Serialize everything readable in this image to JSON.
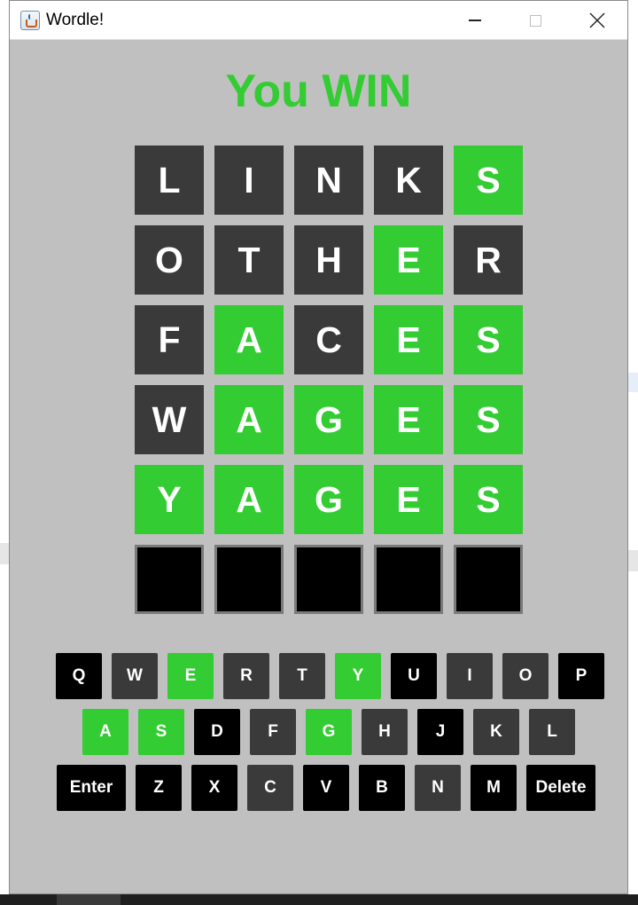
{
  "window": {
    "title": "Wordle!",
    "icon": "java-cup-icon"
  },
  "headline": "You WIN",
  "colors": {
    "green": "#33cc33",
    "gray": "#3a3a3a",
    "black": "#000000",
    "background": "#c0c0c0"
  },
  "board": {
    "rows": [
      [
        {
          "letter": "L",
          "state": "gray"
        },
        {
          "letter": "I",
          "state": "gray"
        },
        {
          "letter": "N",
          "state": "gray"
        },
        {
          "letter": "K",
          "state": "gray"
        },
        {
          "letter": "S",
          "state": "green"
        }
      ],
      [
        {
          "letter": "O",
          "state": "gray"
        },
        {
          "letter": "T",
          "state": "gray"
        },
        {
          "letter": "H",
          "state": "gray"
        },
        {
          "letter": "E",
          "state": "green"
        },
        {
          "letter": "R",
          "state": "gray"
        }
      ],
      [
        {
          "letter": "F",
          "state": "gray"
        },
        {
          "letter": "A",
          "state": "green"
        },
        {
          "letter": "C",
          "state": "gray"
        },
        {
          "letter": "E",
          "state": "green"
        },
        {
          "letter": "S",
          "state": "green"
        }
      ],
      [
        {
          "letter": "W",
          "state": "gray"
        },
        {
          "letter": "A",
          "state": "green"
        },
        {
          "letter": "G",
          "state": "green"
        },
        {
          "letter": "E",
          "state": "green"
        },
        {
          "letter": "S",
          "state": "green"
        }
      ],
      [
        {
          "letter": "Y",
          "state": "green"
        },
        {
          "letter": "A",
          "state": "green"
        },
        {
          "letter": "G",
          "state": "green"
        },
        {
          "letter": "E",
          "state": "green"
        },
        {
          "letter": "S",
          "state": "green"
        }
      ],
      [
        {
          "letter": "",
          "state": "empty"
        },
        {
          "letter": "",
          "state": "empty"
        },
        {
          "letter": "",
          "state": "empty"
        },
        {
          "letter": "",
          "state": "empty"
        },
        {
          "letter": "",
          "state": "empty"
        }
      ]
    ]
  },
  "keyboard": {
    "rows": [
      [
        {
          "label": "Q",
          "state": "black"
        },
        {
          "label": "W",
          "state": "gray"
        },
        {
          "label": "E",
          "state": "green"
        },
        {
          "label": "R",
          "state": "gray"
        },
        {
          "label": "T",
          "state": "gray"
        },
        {
          "label": "Y",
          "state": "green"
        },
        {
          "label": "U",
          "state": "black"
        },
        {
          "label": "I",
          "state": "gray"
        },
        {
          "label": "O",
          "state": "gray"
        },
        {
          "label": "P",
          "state": "black"
        }
      ],
      [
        {
          "label": "A",
          "state": "green"
        },
        {
          "label": "S",
          "state": "green"
        },
        {
          "label": "D",
          "state": "black"
        },
        {
          "label": "F",
          "state": "gray"
        },
        {
          "label": "G",
          "state": "green"
        },
        {
          "label": "H",
          "state": "gray"
        },
        {
          "label": "J",
          "state": "black"
        },
        {
          "label": "K",
          "state": "gray"
        },
        {
          "label": "L",
          "state": "gray"
        }
      ],
      [
        {
          "label": "Enter",
          "state": "black"
        },
        {
          "label": "Z",
          "state": "black"
        },
        {
          "label": "X",
          "state": "black"
        },
        {
          "label": "C",
          "state": "gray"
        },
        {
          "label": "V",
          "state": "black"
        },
        {
          "label": "B",
          "state": "black"
        },
        {
          "label": "N",
          "state": "gray"
        },
        {
          "label": "M",
          "state": "black"
        },
        {
          "label": "Delete",
          "state": "black"
        }
      ]
    ]
  }
}
